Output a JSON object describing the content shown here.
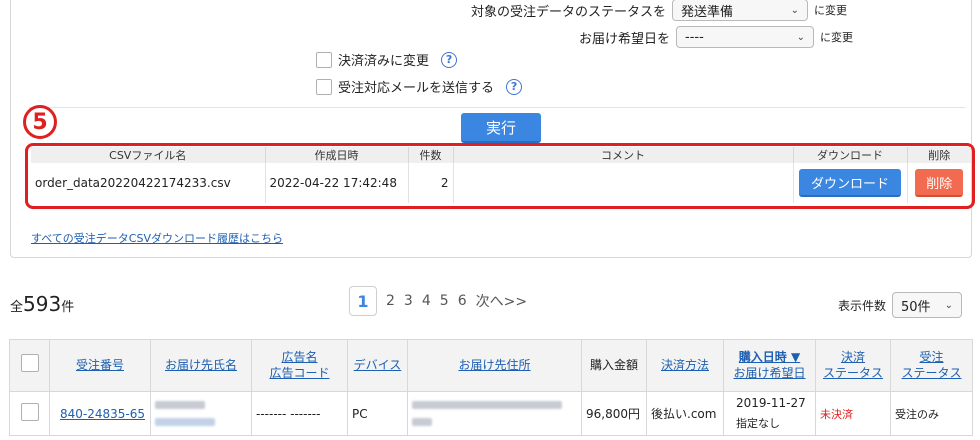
{
  "update": {
    "status_label": "対象の受注データのステータスを",
    "status_value": "発送準備",
    "status_suffix": "に変更",
    "date_label": "お届け希望日を",
    "date_value": "----",
    "date_suffix": "に変更",
    "paid_label": "決済済みに変更",
    "mail_label": "受注対応メールを送信する",
    "run_label": "実行",
    "step_number": "5"
  },
  "csv_table": {
    "headers": [
      "CSVファイル名",
      "作成日時",
      "件数",
      "コメント",
      "ダウンロード",
      "削除"
    ],
    "row": {
      "filename": "order_data20220422174233.csv",
      "created": "2022-04-22 17:42:48",
      "count": "2",
      "comment": "",
      "download_label": "ダウンロード",
      "delete_label": "削除"
    }
  },
  "history_link": "すべての受注データCSVダウンロード履歴はこちら",
  "summary": {
    "prefix": "全",
    "count": "593",
    "suffix": "件"
  },
  "pagination": {
    "current": "1",
    "pages": [
      "2",
      "3",
      "4",
      "5",
      "6"
    ],
    "next": "次へ>>"
  },
  "per_page": {
    "label": "表示件数",
    "value": "50件"
  },
  "orders_table": {
    "headers": {
      "order_no": "受注番号",
      "recipient": "お届け先氏名",
      "ad_name": "広告名",
      "ad_code": "広告コード",
      "device": "デバイス",
      "address": "お届け先住所",
      "amount": "購入金額",
      "payment": "決済方法",
      "purchase_date": "購入日時 ▼",
      "delivery_date": "お届け希望日",
      "pay_status_1": "決済",
      "pay_status_2": "ステータス",
      "order_status_1": "受注",
      "order_status_2": "ステータス"
    },
    "row": {
      "order_no": "840-24835-65",
      "ad": "------- -------",
      "device": "PC",
      "amount": "96,800円",
      "payment": "後払い.com",
      "purchase_date": "2019-11-27",
      "delivery_date": "指定なし",
      "pay_status": "未決済",
      "order_status": "受注のみ"
    }
  },
  "colors": {
    "accent": "#3b86e0",
    "danger": "#f26a4f",
    "highlight": "#e02020",
    "link": "#1d5fb0"
  }
}
